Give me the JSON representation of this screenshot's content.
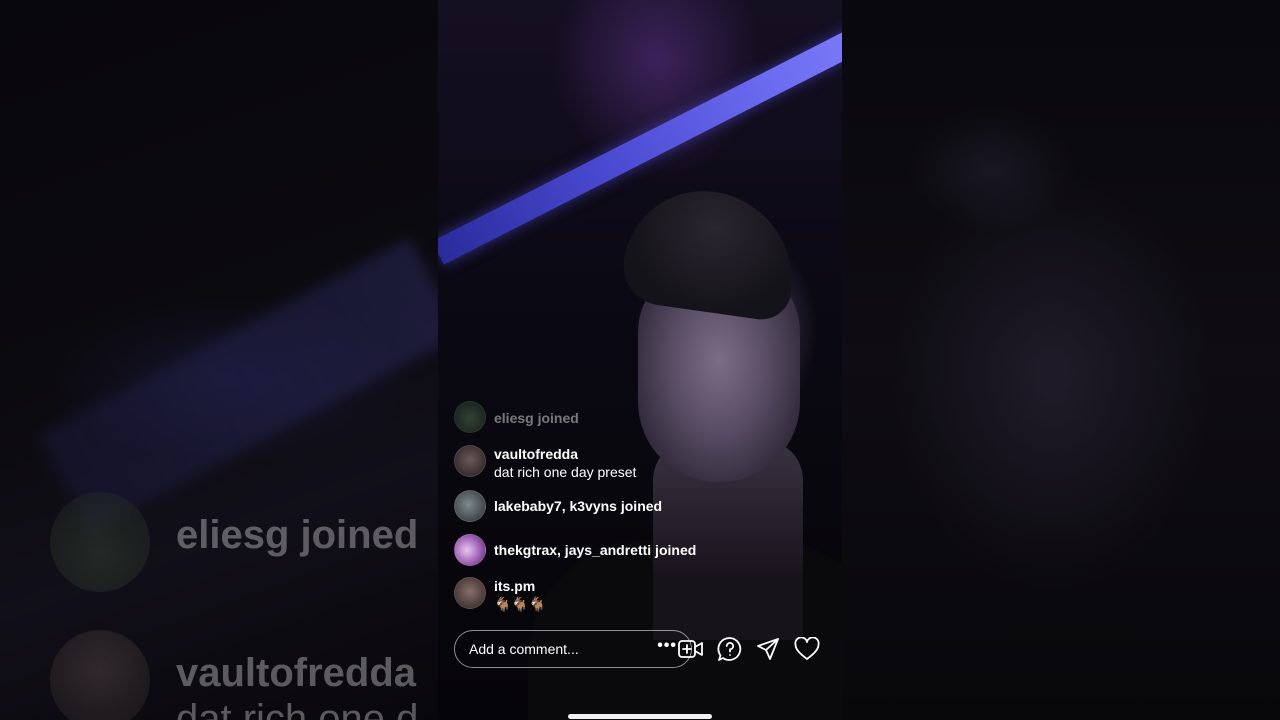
{
  "background": {
    "left_comments": [
      {
        "user": "eliesg joined",
        "text": ""
      },
      {
        "user": "vaultofredda",
        "text": "dat rich one d"
      }
    ]
  },
  "live": {
    "comments": [
      {
        "user": "eliesg joined",
        "text": "",
        "faded": true
      },
      {
        "user": "vaultofredda",
        "text": "dat rich one day preset"
      },
      {
        "user": "lakebaby7, k3vyns joined",
        "text": ""
      },
      {
        "user": "thekgtrax, jays_andretti joined",
        "text": ""
      },
      {
        "user": "its.pm",
        "text": "🐐🐐🐐"
      }
    ],
    "input": {
      "placeholder": "Add a comment...",
      "more_label": "•••"
    },
    "actions": [
      "add-guest-video-icon",
      "question-icon",
      "send-icon",
      "heart-icon"
    ]
  },
  "colors": {
    "beam": "#4a4ad0",
    "text": "#ffffff"
  }
}
